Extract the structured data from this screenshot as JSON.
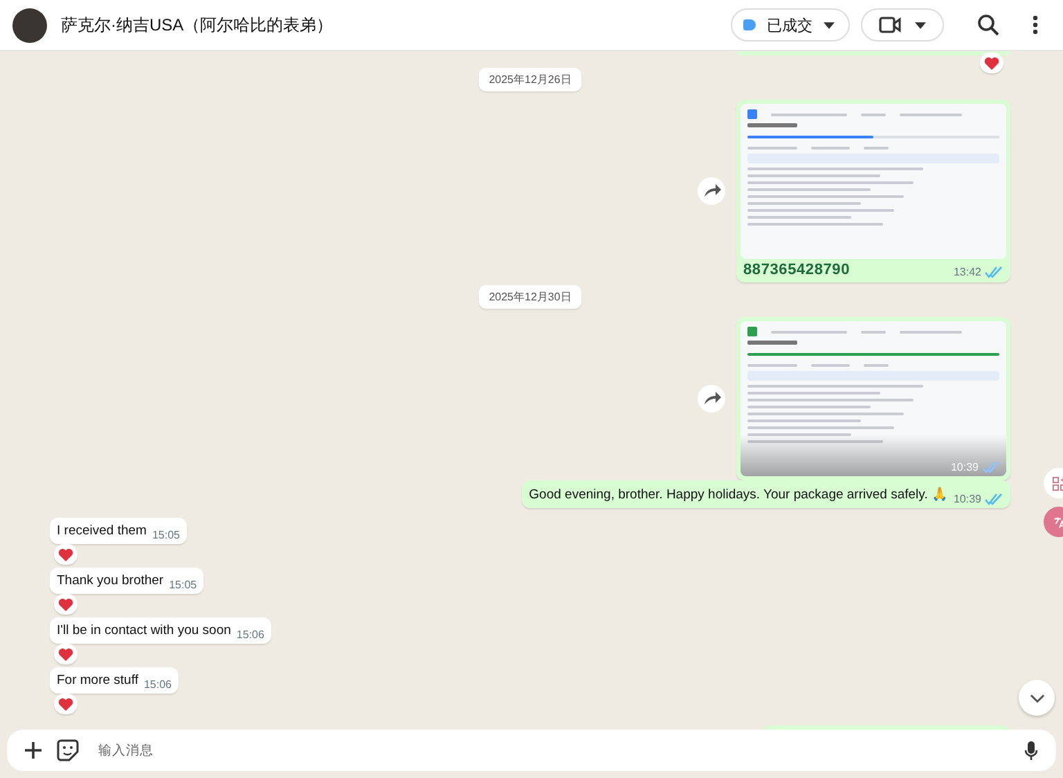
{
  "header": {
    "contact_name": "萨克尔·纳吉USA（阿尔哈比的表弟）",
    "label_button": {
      "text": "已成交",
      "color": "#4a9ff5"
    }
  },
  "messages": [
    {
      "kind": "tail",
      "reacted": true
    },
    {
      "kind": "date",
      "text": "2025年12月26日"
    },
    {
      "kind": "image",
      "outgoing": true,
      "caption": "887365428790",
      "time": "13:42",
      "read": true,
      "thumb": {
        "color": "#3b82f6",
        "level": 0.5
      }
    },
    {
      "kind": "date",
      "text": "2025年12月30日"
    },
    {
      "kind": "image",
      "outgoing": true,
      "time": "10:39",
      "read": true,
      "thumb": {
        "color": "#2e9e4f",
        "level": 1
      }
    },
    {
      "kind": "text",
      "outgoing": true,
      "text": "Good evening, brother. Happy holidays. Your package arrived safely. 🙏",
      "time": "10:39",
      "read": true,
      "reacted": false
    },
    {
      "kind": "text",
      "outgoing": false,
      "text": "I received them",
      "time": "15:05",
      "reacted": true
    },
    {
      "kind": "text",
      "outgoing": false,
      "text": "Thank you brother",
      "time": "15:05",
      "reacted": true
    },
    {
      "kind": "text",
      "outgoing": false,
      "text": "I'll be in contact with you soon",
      "time": "15:06",
      "reacted": true
    },
    {
      "kind": "text",
      "outgoing": false,
      "text": "For more stuff",
      "time": "15:06",
      "reacted": true
    },
    {
      "kind": "hidden"
    }
  ],
  "composer": {
    "placeholder": "输入消息"
  }
}
